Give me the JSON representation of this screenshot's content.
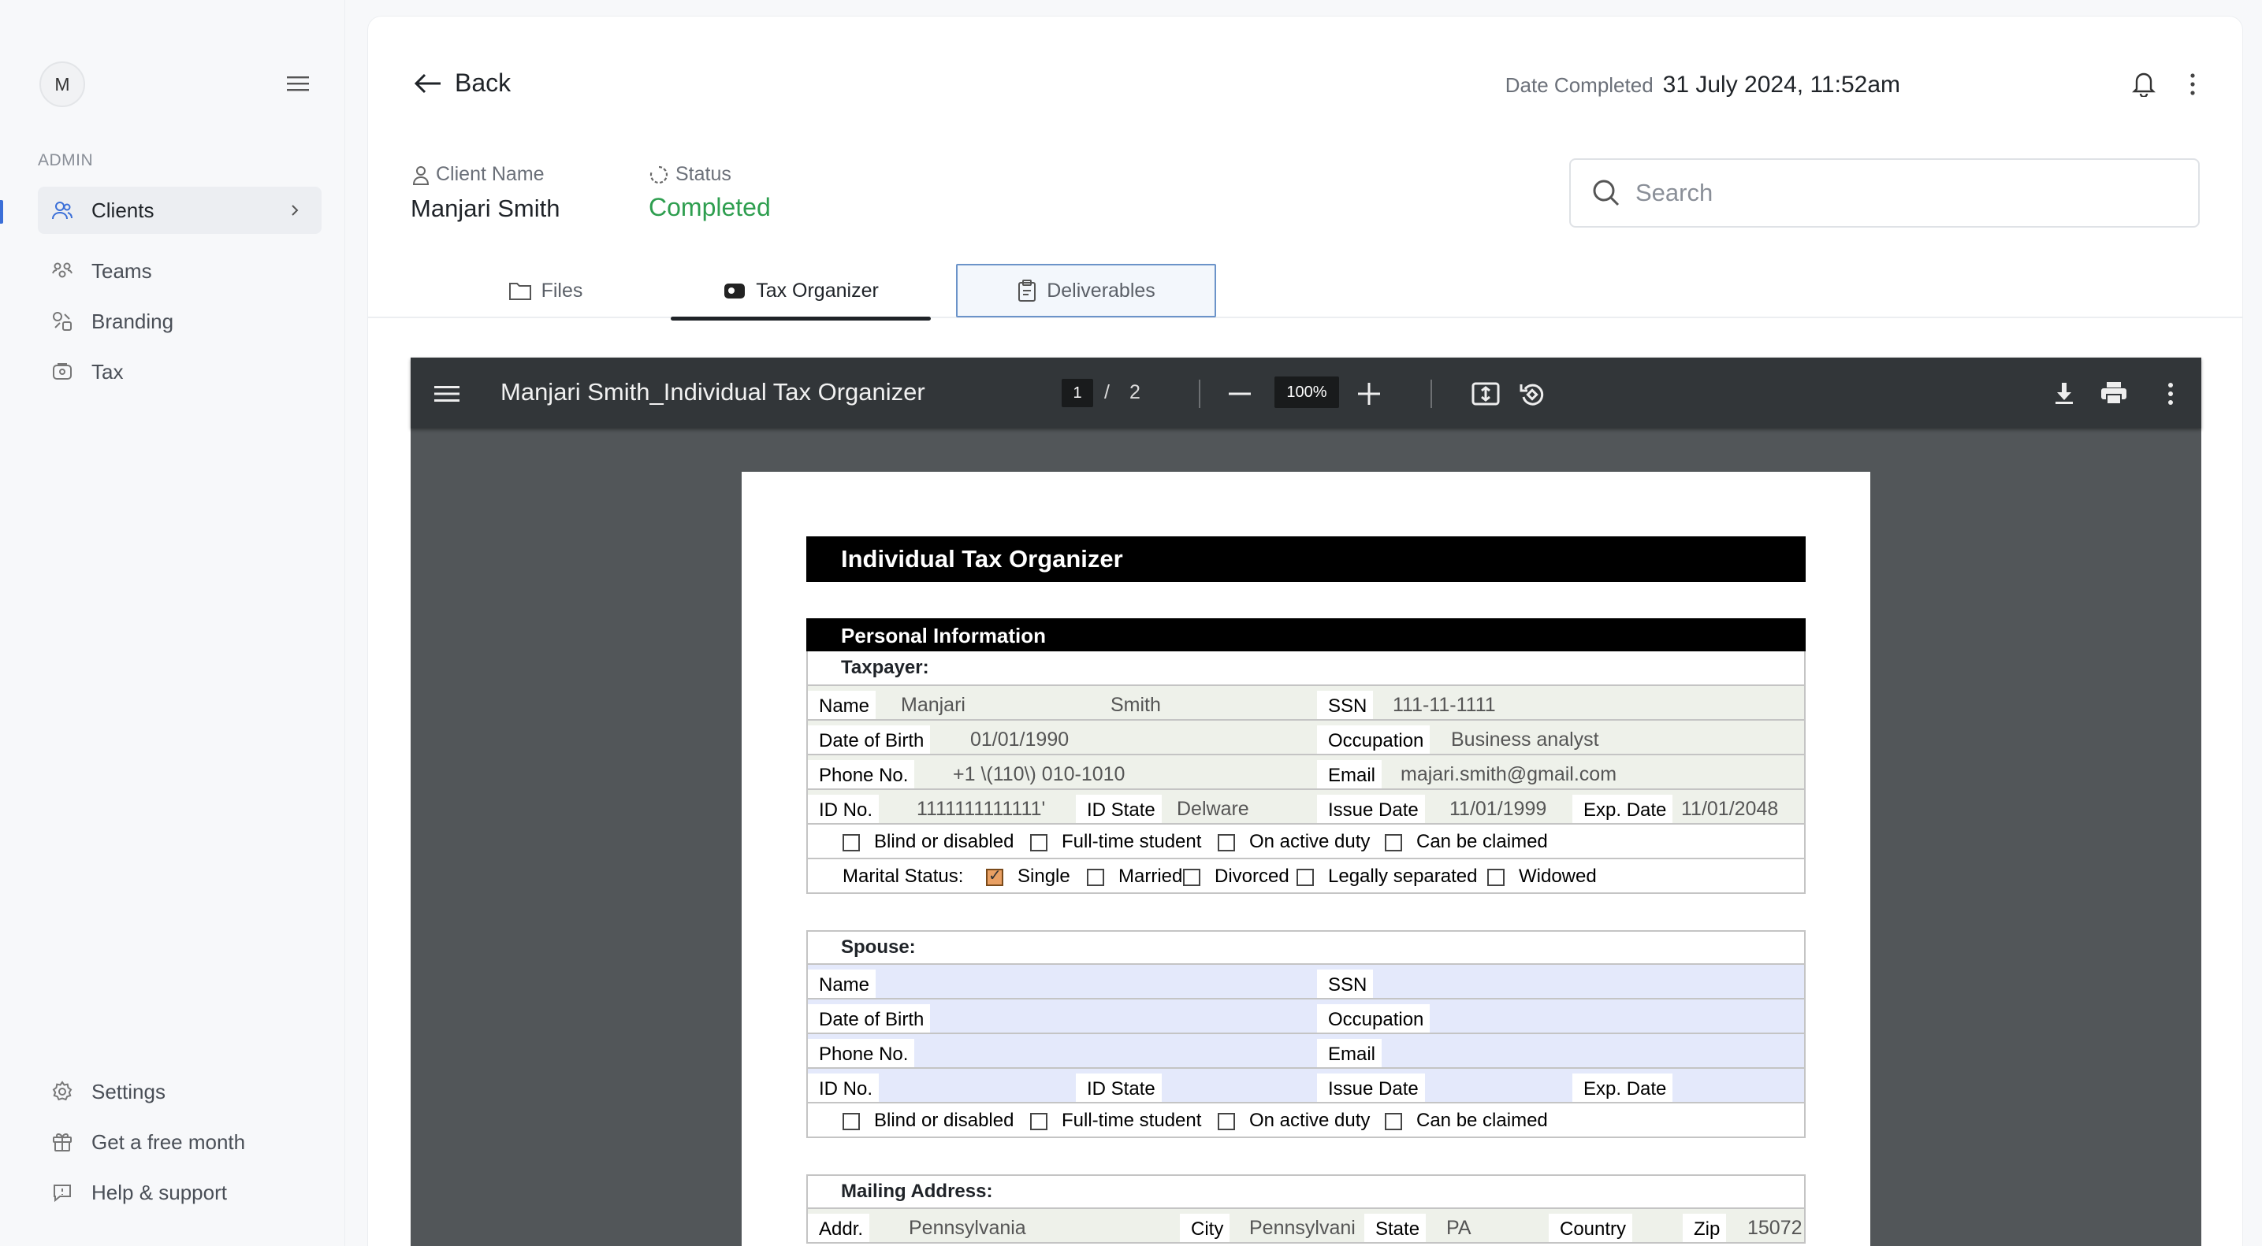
{
  "user": {
    "avatar_initial": "M"
  },
  "sidebar": {
    "section_label": "ADMIN",
    "items": [
      {
        "label": "Clients",
        "icon": "users-icon",
        "active": true
      },
      {
        "label": "Teams",
        "icon": "teams-icon"
      },
      {
        "label": "Branding",
        "icon": "branding-icon"
      },
      {
        "label": "Tax",
        "icon": "tax-icon"
      }
    ],
    "footer": [
      {
        "label": "Settings",
        "icon": "gear-icon"
      },
      {
        "label": "Get a free month",
        "icon": "gift-icon"
      },
      {
        "label": "Help & support",
        "icon": "chat-icon"
      }
    ]
  },
  "header": {
    "back_label": "Back",
    "date_label": "Date Completed",
    "date_value": "31 July 2024, 11:52am",
    "client_label": "Client Name",
    "client_value": "Manjari Smith",
    "status_label": "Status",
    "status_value": "Completed",
    "status_color": "#2e9e4f",
    "search_placeholder": "Search"
  },
  "tabs": [
    {
      "label": "Files"
    },
    {
      "label": "Tax Organizer",
      "active": true
    },
    {
      "label": "Deliverables"
    }
  ],
  "pdf": {
    "title": "Manjari Smith_Individual Tax Organizer",
    "page_current": "1",
    "page_sep": "/",
    "page_total": "2",
    "zoom": "100%"
  },
  "doc": {
    "title": "Individual Tax Organizer",
    "section_personal": "Personal Information",
    "taxpayer": {
      "heading": "Taxpayer:",
      "name_label": "Name",
      "first_name": "Manjari",
      "last_name": "Smith",
      "ssn_label": "SSN",
      "ssn": "111-11-1111",
      "dob_label": "Date of Birth",
      "dob": "01/01/1990",
      "occupation_label": "Occupation",
      "occupation": "Business analyst",
      "phone_label": "Phone No.",
      "phone": "+1 \\(110\\) 010-1010",
      "email_label": "Email",
      "email": "majari.smith@gmail.com",
      "id_label": "ID No.",
      "id_no": "1111111111111'",
      "id_state_label": "ID State",
      "id_state": "Delware",
      "issue_label": "Issue Date",
      "issue_date": "11/01/1999",
      "exp_label": "Exp. Date",
      "exp_date": "11/01/2048",
      "checks": [
        "Blind or disabled",
        "Full-time student",
        "On active duty",
        "Can be claimed"
      ],
      "marital_label": "Marital Status:",
      "marital_options": [
        "Single",
        "Married",
        "Divorced",
        "Legally separated",
        "Widowed"
      ]
    },
    "spouse": {
      "heading": "Spouse:",
      "name_label": "Name",
      "ssn_label": "SSN",
      "dob_label": "Date of Birth",
      "occupation_label": "Occupation",
      "phone_label": "Phone No.",
      "email_label": "Email",
      "id_label": "ID No.",
      "id_state_label": "ID State",
      "issue_label": "Issue Date",
      "exp_label": "Exp. Date",
      "checks": [
        "Blind or disabled",
        "Full-time student",
        "On active duty",
        "Can be claimed"
      ]
    },
    "mailing": {
      "heading": "Mailing Address:",
      "addr_label": "Addr.",
      "addr": "Pennsylvania",
      "city_label": "City",
      "city": "Pennsylvani",
      "state_label": "State",
      "state": "PA",
      "country_label": "Country",
      "zip_label": "Zip",
      "zip": "15072"
    }
  }
}
